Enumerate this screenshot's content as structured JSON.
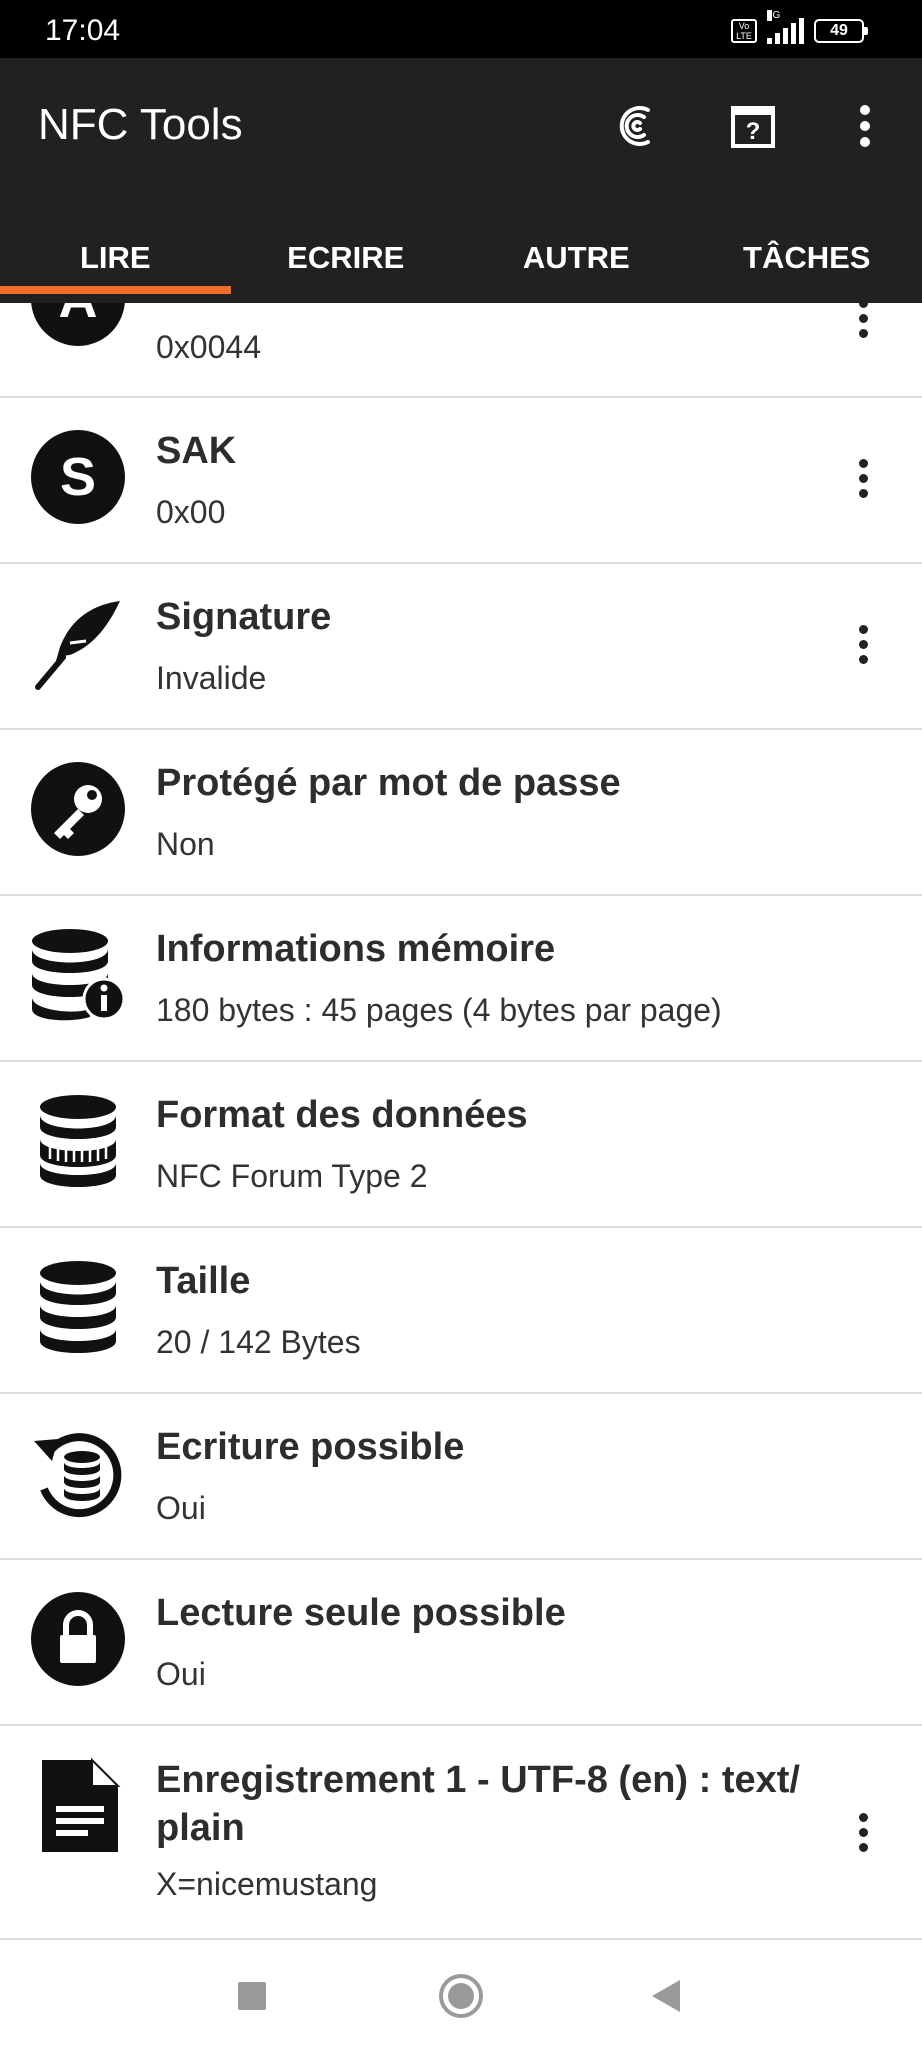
{
  "status_bar": {
    "time": "17:04",
    "volte": "Vo LTE",
    "network": "5G",
    "battery": "49"
  },
  "app_bar": {
    "title": "NFC Tools",
    "icons": [
      "nfc-logo-icon",
      "help-icon",
      "overflow-menu-icon"
    ]
  },
  "tabs": [
    {
      "label": "LIRE",
      "active": true
    },
    {
      "label": "ECRIRE",
      "active": false
    },
    {
      "label": "AUTRE",
      "active": false
    },
    {
      "label": "TÂCHES",
      "active": false
    }
  ],
  "rows": [
    {
      "icon": "atqa-a-icon",
      "title": "",
      "value": "0x0044",
      "menu": true
    },
    {
      "icon": "sak-s-icon",
      "title": "SAK",
      "value": "0x00",
      "menu": true
    },
    {
      "icon": "feather-icon",
      "title": "Signature",
      "value": "Invalide",
      "menu": true
    },
    {
      "icon": "key-icon",
      "title": "Protégé par mot de passe",
      "value": "Non",
      "menu": false
    },
    {
      "icon": "database-info-icon",
      "title": "Informations mémoire",
      "value": "180 bytes : 45 pages (4 bytes par page)",
      "menu": false
    },
    {
      "icon": "database-format-icon",
      "title": "Format des données",
      "value": "NFC Forum Type 2",
      "menu": false
    },
    {
      "icon": "database-icon",
      "title": "Taille",
      "value": "20 / 142 Bytes",
      "menu": false
    },
    {
      "icon": "database-rewrite-icon",
      "title": "Ecriture possible",
      "value": "Oui",
      "menu": false
    },
    {
      "icon": "lock-icon",
      "title": "Lecture seule possible",
      "value": "Oui",
      "menu": false
    },
    {
      "icon": "document-icon",
      "title": "Enregistrement 1 - UTF-8 (en) : text/\nplain",
      "title_line1": "Enregistrement 1 - UTF-8 (en) : text/",
      "title_line2": "plain",
      "value": "X=nicemustang",
      "menu": true
    }
  ],
  "nav_bar": {
    "icons": [
      "recents-square-icon",
      "home-circle-icon",
      "back-triangle-icon"
    ]
  },
  "colors": {
    "app_bar": "#212121",
    "accent": "#f36b2b",
    "status_bar": "#000000"
  }
}
